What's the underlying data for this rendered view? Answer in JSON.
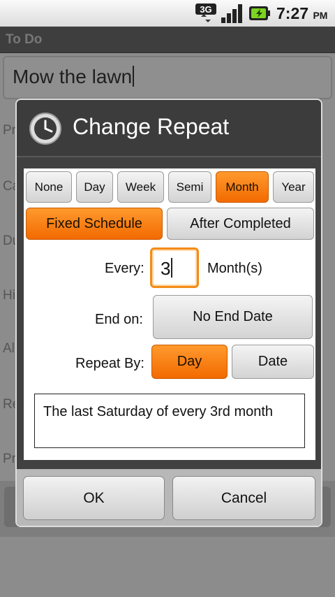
{
  "status_bar": {
    "network": "3G",
    "time": "7:27",
    "ampm": "PM",
    "icons": [
      "3g-data-icon",
      "signal-icon",
      "battery-charging-icon"
    ]
  },
  "background_app": {
    "title": "To Do",
    "task_value": "Mow the lawn",
    "labels": [
      "Pri",
      "Ca",
      "Du",
      "Hi",
      "Al",
      "Re",
      "Private:"
    ]
  },
  "dialog": {
    "title": "Change Repeat",
    "icon": "clock-icon",
    "frequency_options": [
      "None",
      "Day",
      "Week",
      "Semi",
      "Month",
      "Year"
    ],
    "frequency_selected": "Month",
    "schedule_modes": [
      "Fixed Schedule",
      "After Completed"
    ],
    "schedule_mode_selected": "Fixed Schedule",
    "every_label": "Every:",
    "every_value": "3",
    "every_unit": "Month(s)",
    "end_on_label": "End on:",
    "end_on_value": "No End Date",
    "repeat_by_label": "Repeat By:",
    "repeat_by_options": [
      "Day",
      "Date"
    ],
    "repeat_by_selected": "Day",
    "summary": "The last Saturday of every 3rd month",
    "ok_label": "OK",
    "cancel_label": "Cancel"
  },
  "colors": {
    "accent": "#f57c0d",
    "dialog_bg": "#414141",
    "body_bg": "#ffffff"
  }
}
